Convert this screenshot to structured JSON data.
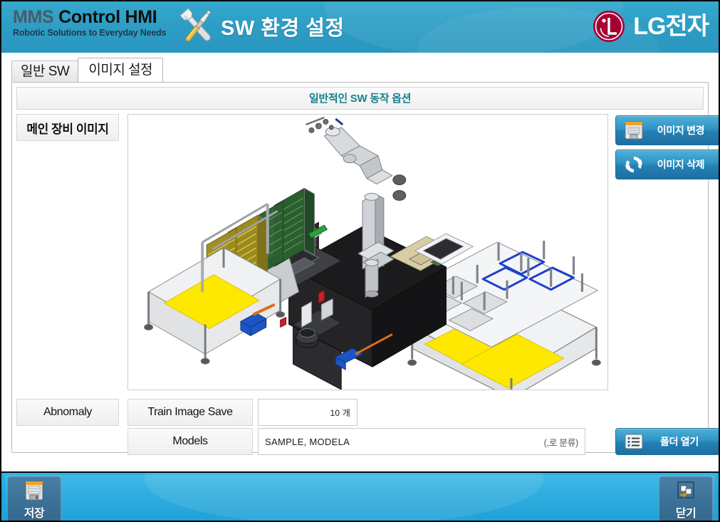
{
  "header": {
    "brand_top_mms": "MMS",
    "brand_top_rest": " Control HMI",
    "brand_tagline": "Robotic Solutions to Everyday Needs",
    "page_title": "SW 환경 설정",
    "tools_icon": "wrench-screwdriver-icon",
    "logo_text": "LG전자",
    "logo_mark": "lg-face-logo",
    "bg_color": "#2f9fc6"
  },
  "tabs": [
    {
      "label": "일반 SW",
      "active": false
    },
    {
      "label": "이미지 설정",
      "active": true
    }
  ],
  "section": {
    "title": "일반적인 SW 동작 옵션",
    "title_color": "#16808c"
  },
  "form": {
    "main_image_label": "메인 장비 이미지",
    "abnomaly_label": "Abnomaly",
    "train_image_save_label": "Train Image Save",
    "train_image_save_value": "10 개",
    "models_label": "Models",
    "models_value": "SAMPLE, MODELA",
    "models_hint": "(,로 분류)"
  },
  "buttons": {
    "image_change": {
      "label": "이미지 변경",
      "icon": "floppy-disk-icon"
    },
    "image_delete": {
      "label": "이미지 삭제",
      "icon": "refresh-cycle-icon"
    },
    "open_folder": {
      "label": "폴더 열기",
      "icon": "list-view-icon"
    },
    "save": {
      "label": "저장",
      "icon": "floppy-disk-icon"
    },
    "close": {
      "label": "닫기",
      "icon": "exit-window-icon"
    },
    "accent_color": "#2380b4"
  },
  "preview": {
    "alt": "3D CAD rendering of robotic semiconductor handling equipment with cassette racks, robot arm, vacuum chamber and transport carts"
  }
}
